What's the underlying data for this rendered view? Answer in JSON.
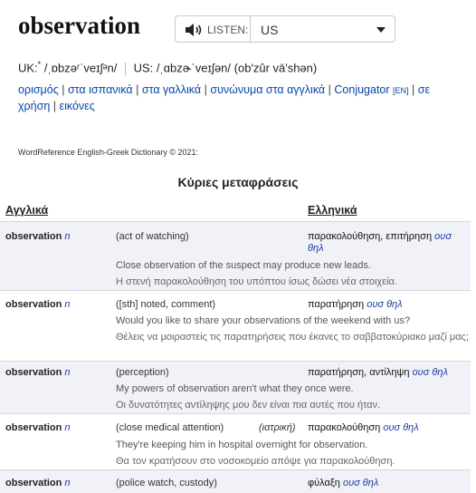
{
  "header": {
    "word": "observation",
    "listen_label": "LISTEN:",
    "accent": "US",
    "pron": {
      "uk_label": "UK:",
      "uk_sup": "*",
      "uk_ipa": "/ˌɒbzəʳˈveɪʃᵊn/",
      "us_label": "US:",
      "us_ipa": "/ˌɑbzɚˈveɪʃən/",
      "us_alt": "(ob′zûr vā′shən)"
    },
    "links": [
      "ορισμός",
      "στα ισπανικά",
      "στα γαλλικά",
      "συνώνυμα στα αγγλικά",
      "Conjugator",
      "σε χρήση",
      "εικόνες"
    ],
    "links_tag": "[EN]",
    "copyright": "WordReference English-Greek Dictionary © 2021:"
  },
  "section": {
    "heading": "Κύριες μεταφράσεις",
    "col_en": "Αγγλικά",
    "col_gr": "Ελληνικά"
  },
  "entries": [
    {
      "term": "observation",
      "pos": "n",
      "sense": "(act of watching)",
      "domain": "",
      "translation": "παρακολούθηση, επιτήρηση",
      "tr_pos": "ουσ θηλ",
      "example_en": "Close observation of the suspect may produce new leads.",
      "example_gr": "Η στενή παρακολούθηση του υπόπτου ίσως δώσει νέα στοιχεία."
    },
    {
      "term": "observation",
      "pos": "n",
      "sense": "([sth] noted, comment)",
      "domain": "",
      "translation": "παρατήρηση",
      "tr_pos": "ουσ θηλ",
      "example_en": "Would you like to share your observations of the weekend with us?",
      "example_gr": "Θέλεις να μοιραστείς τις παρατηρήσεις που έκανες το σαββατοκύριακο μαζί μας;"
    },
    {
      "term": "observation",
      "pos": "n",
      "sense": "(perception)",
      "domain": "",
      "translation": "παρατήρηση, αντίληψη",
      "tr_pos": "ουσ θηλ",
      "example_en": "My powers of observation aren't what they once were.",
      "example_gr": "Οι δυνατότητες αντίληψης μου δεν είναι πια αυτές που ήταν."
    },
    {
      "term": "observation",
      "pos": "n",
      "sense": "(close medical attention)",
      "domain": "(ιατρική)",
      "translation": "παρακολούθηση",
      "tr_pos": "ουσ θηλ",
      "example_en": "They're keeping him in hospital overnight for observation.",
      "example_gr": "Θα τον κρατήσουν στο νοσοκομείο απόψε για παρακολούθηση."
    },
    {
      "term": "observation",
      "pos": "n",
      "sense": "(police watch, custody)",
      "domain": "",
      "translation": "φύλαξη",
      "tr_pos": "ουσ θηλ",
      "example_en": "",
      "example_gr": ""
    }
  ]
}
